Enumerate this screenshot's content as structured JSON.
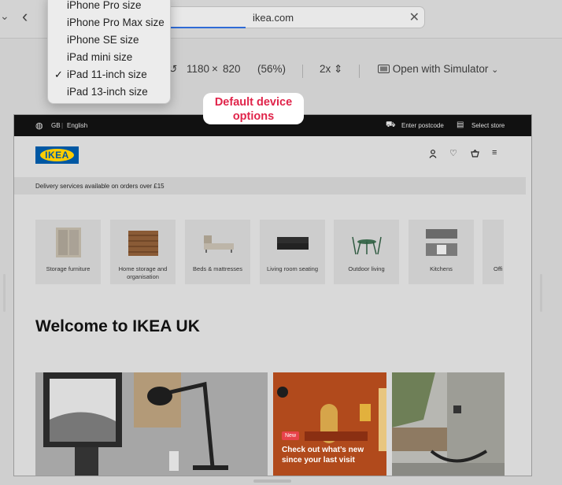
{
  "toolbar": {
    "url": "ikea.com"
  },
  "responsive": {
    "width": "1180",
    "times": "×",
    "height": "820",
    "zoom": "(56%)",
    "scale": "2x",
    "simulator_label": "Open with Simulator"
  },
  "menu": {
    "items": [
      {
        "label": "iPhone Pro size",
        "checked": false
      },
      {
        "label": "iPhone Pro Max size",
        "checked": false
      },
      {
        "label": "iPhone SE size",
        "checked": false
      },
      {
        "label": "iPad mini size",
        "checked": false
      },
      {
        "label": "iPad 11-inch size",
        "checked": true
      },
      {
        "label": "iPad 13-inch size",
        "checked": false
      }
    ]
  },
  "callout": {
    "line1": "Default device",
    "line2": "options"
  },
  "ikea": {
    "locale_country": "GB",
    "locale_language": "English",
    "postcode_label": "Enter postcode",
    "store_label": "Select store",
    "logo": "IKEA",
    "delivery_notice": "Delivery services available on orders over £15",
    "categories": [
      "Storage furniture",
      "Home storage and organisation",
      "Beds & mattresses",
      "Living room seating",
      "Outdoor living",
      "Kitchens",
      "Offi"
    ],
    "welcome": "Welcome to IKEA UK",
    "promo_badge": "New",
    "promo_text_1": "Check out what’s new",
    "promo_text_2": "since your last visit"
  },
  "colors": {
    "ikea_blue": "#0058a3",
    "ikea_yellow": "#ffcc00",
    "accent_red": "#e0244a"
  }
}
